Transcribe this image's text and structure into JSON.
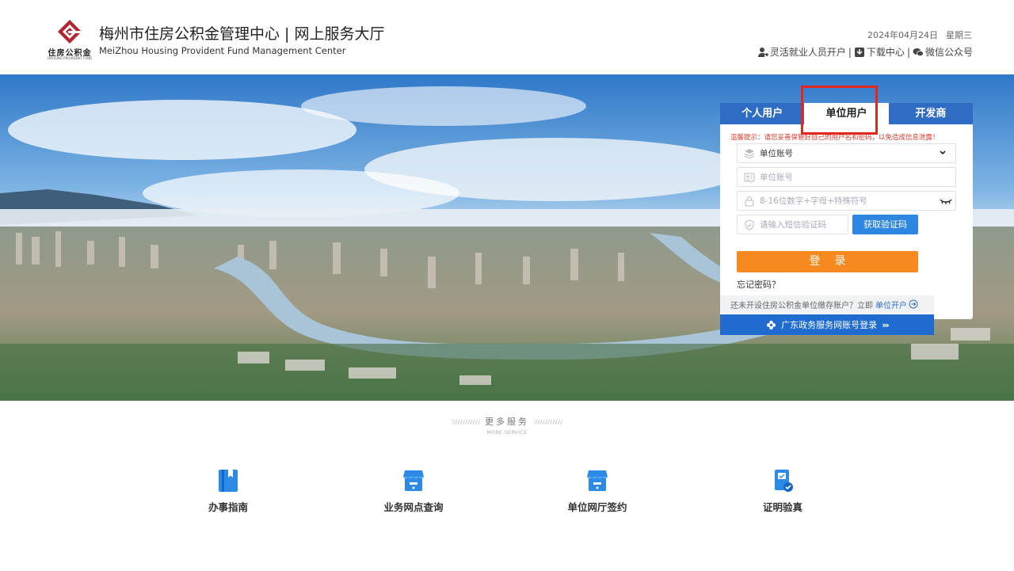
{
  "header": {
    "logo_cn": "住房公积金",
    "logo_en": "HOUSING PROVIDENT FUND",
    "title": "梅州市住房公积金管理中心 | 网上服务大厅",
    "subtitle": "MeiZhou Housing Provident Fund Management Center",
    "date": "2024年04月24日",
    "weekday": "星期三",
    "links": [
      {
        "label": "灵活就业人员开户",
        "icon": "user-plus-icon"
      },
      {
        "label": "下载中心",
        "icon": "download-icon"
      },
      {
        "label": "微信公众号",
        "icon": "wechat-icon"
      }
    ],
    "separator": "|"
  },
  "login": {
    "tabs": [
      {
        "label": "个人用户",
        "active": false
      },
      {
        "label": "单位用户",
        "active": true
      },
      {
        "label": "开发商",
        "active": false
      }
    ],
    "tip": "温馨提示：请您妥善保管好自己的用户名和密码，以免造成信息泄露！",
    "account_type": "单位账号",
    "account_placeholder": "单位账号",
    "password_placeholder": "8-16位数字+字母+特殊符号",
    "sms_placeholder": "请输入短信验证码",
    "sms_button": "获取验证码",
    "login_button": "登录",
    "forgot": "忘记密码？",
    "open_prompt": "还未开设住房公积金单位缴存账户？立即",
    "open_link": "单位开户",
    "gd_login": "广东政务服务网账号登录",
    "gd_arrows": "›››"
  },
  "services": {
    "title": "更多服务",
    "title_en": "MORE SERVICE",
    "items": [
      {
        "label": "办事指南",
        "icon": "guide-book-icon"
      },
      {
        "label": "业务网点查询",
        "icon": "branch-store-icon"
      },
      {
        "label": "单位网厅签约",
        "icon": "contract-store-icon"
      },
      {
        "label": "证明验真",
        "icon": "certificate-verify-icon"
      }
    ]
  },
  "colors": {
    "primary_blue": "#2f6dc4",
    "login_orange": "#f78a1e",
    "highlight_red": "#e4261c",
    "logo_red": "#b3262e"
  }
}
